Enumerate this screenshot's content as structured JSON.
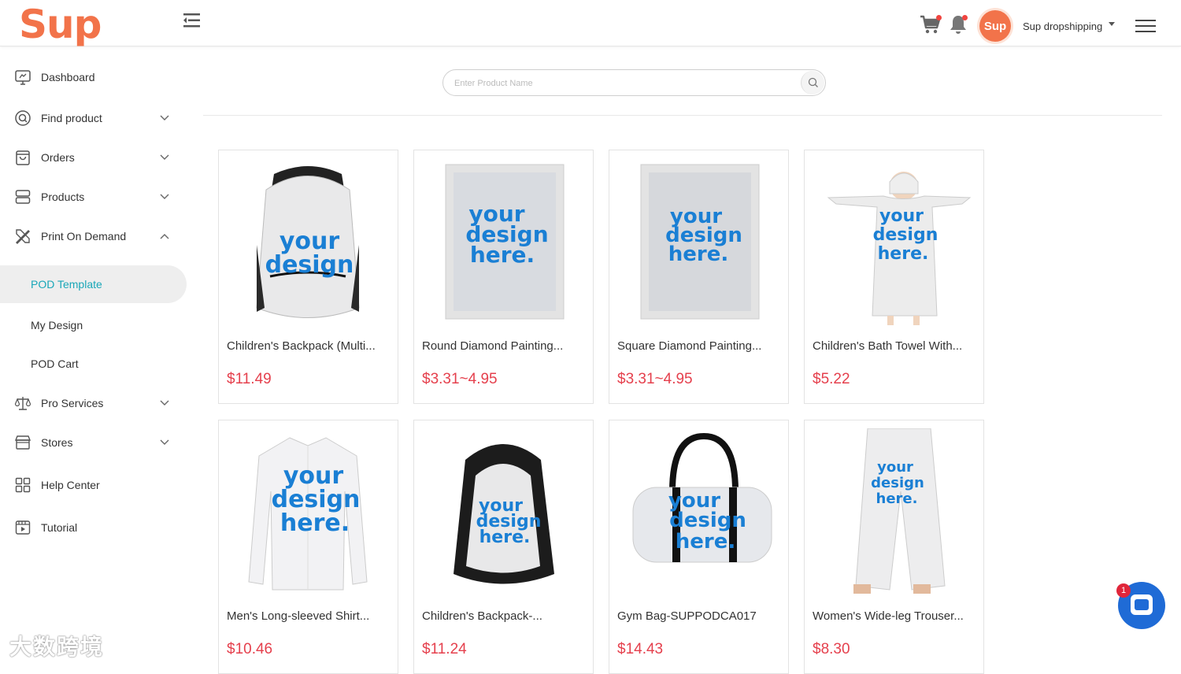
{
  "header": {
    "logo": "Sup",
    "avatar_text": "Sup",
    "user_name": "Sup dropshipping"
  },
  "sidebar": {
    "items": [
      {
        "label": "Dashboard"
      },
      {
        "label": "Find product"
      },
      {
        "label": "Orders"
      },
      {
        "label": "Products"
      },
      {
        "label": "Print On Demand"
      },
      {
        "label": "Pro Services"
      },
      {
        "label": "Stores"
      },
      {
        "label": "Help Center"
      },
      {
        "label": "Tutorial"
      }
    ],
    "pod_sub": [
      {
        "label": "POD Template",
        "active": true
      },
      {
        "label": "My Design"
      },
      {
        "label": "POD Cart"
      }
    ]
  },
  "search": {
    "placeholder": "Enter Product Name",
    "value": ""
  },
  "products": [
    {
      "title": "Children's Backpack (Multi...",
      "price": "$11.49"
    },
    {
      "title": "Round Diamond Painting...",
      "price": "$3.31~4.95"
    },
    {
      "title": "Square Diamond Painting...",
      "price": "$3.31~4.95"
    },
    {
      "title": "Children's Bath Towel With...",
      "price": "$5.22"
    },
    {
      "title": "Men's Long-sleeved Shirt...",
      "price": "$10.46"
    },
    {
      "title": "Children's Backpack-...",
      "price": "$11.24"
    },
    {
      "title": "Gym Bag-SUPPODCA017",
      "price": "$14.43"
    },
    {
      "title": "Women's Wide-leg Trouser...",
      "price": "$8.30"
    }
  ],
  "mockup_text": [
    "your",
    "design",
    "here."
  ],
  "chat": {
    "badge": "1"
  },
  "watermark": "大数跨境",
  "colors": {
    "brand": "#f2734a",
    "active": "#1aa7b8",
    "price": "#e5404d",
    "chat": "#1f6bd6"
  }
}
